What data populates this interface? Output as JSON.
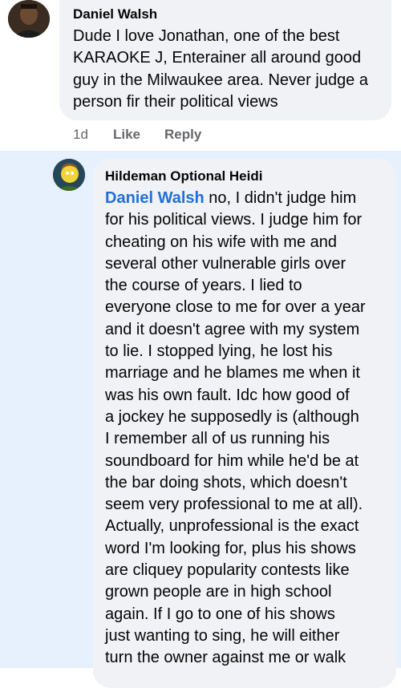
{
  "comments": [
    {
      "author": "Daniel Walsh",
      "lines": [
        "Dude I  love Jonathan, one of the best",
        "KARAOKE J, Enterainer all around good",
        "guy in the Milwaukee area. Never judge a",
        "person fir their political views"
      ],
      "timestamp": "1d",
      "like_label": "Like",
      "reply_label": "Reply"
    },
    {
      "author": "Hildeman Optional Heidi",
      "mention": "Daniel Walsh",
      "first_line_rest": " no, I didn't judge him",
      "lines": [
        "for his political views. I judge him for",
        "cheating on his wife with me and",
        "several other vulnerable girls over",
        "the course of years. I lied to",
        "everyone close to me for over a year",
        "and it doesn't agree with my system",
        "to lie. I stopped lying, he lost his",
        "marriage and he blames me when it",
        "was his own fault. Idc how good of",
        "a jockey he supposedly is (although",
        "I remember all of us running his",
        "soundboard for him while he'd be at",
        "the bar doing shots, which doesn't",
        "seem very professional to me at all).",
        "Actually, unprofessional is the exact",
        "word I'm looking for, plus his shows",
        "are cliquey popularity contests like",
        "grown people are in high school",
        "again. If I go to one of his shows",
        "just wanting to sing, he will either",
        "turn the owner against me or walk"
      ]
    }
  ]
}
